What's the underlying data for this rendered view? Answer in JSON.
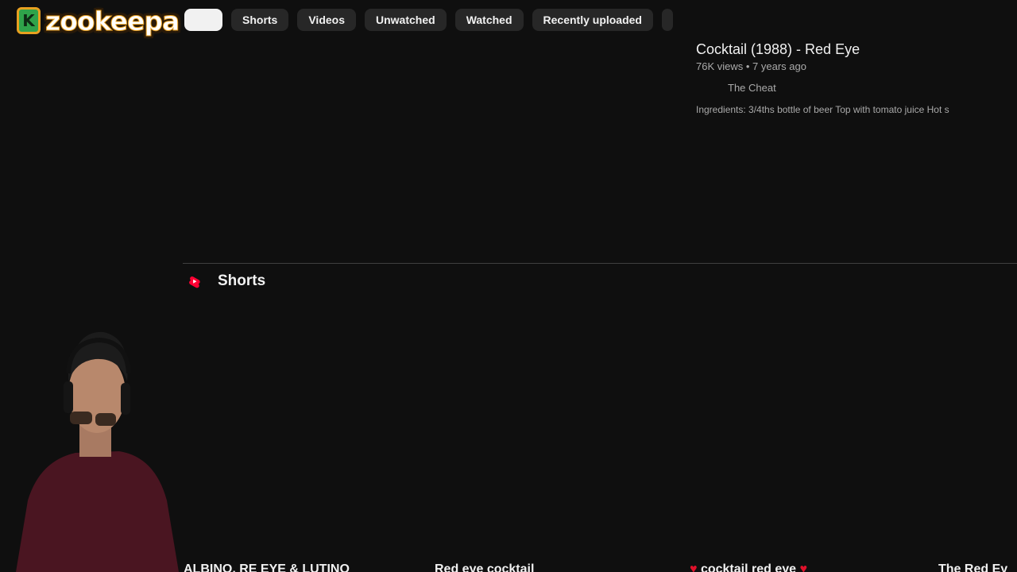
{
  "filters": {
    "items": [
      "Shorts",
      "Videos",
      "Unwatched",
      "Watched",
      "Recently uploaded"
    ]
  },
  "overlay": {
    "logo_text": "zookeepa",
    "logo_letter": "K"
  },
  "featured_video": {
    "title": "Cocktail (1988) - Red Eye",
    "meta": "76K views • 7 years ago",
    "channel": "The Cheat",
    "description": "Ingredients: 3/4ths bottle of beer Top with tomato juice Hot s"
  },
  "shorts_section": {
    "title": "Shorts",
    "items": [
      {
        "title": "ALBINO, RE  EYE & LUTINO"
      },
      {
        "title": "Red eye cocktail"
      },
      {
        "title": "cocktail red eye",
        "hearts": true
      },
      {
        "title": "The Red Ey"
      }
    ]
  },
  "colors": {
    "background": "#0f0f0f",
    "chip": "#272727",
    "accent": "#ff0033",
    "logo_orange": "#e8a020",
    "logo_green": "#2fa34a"
  }
}
